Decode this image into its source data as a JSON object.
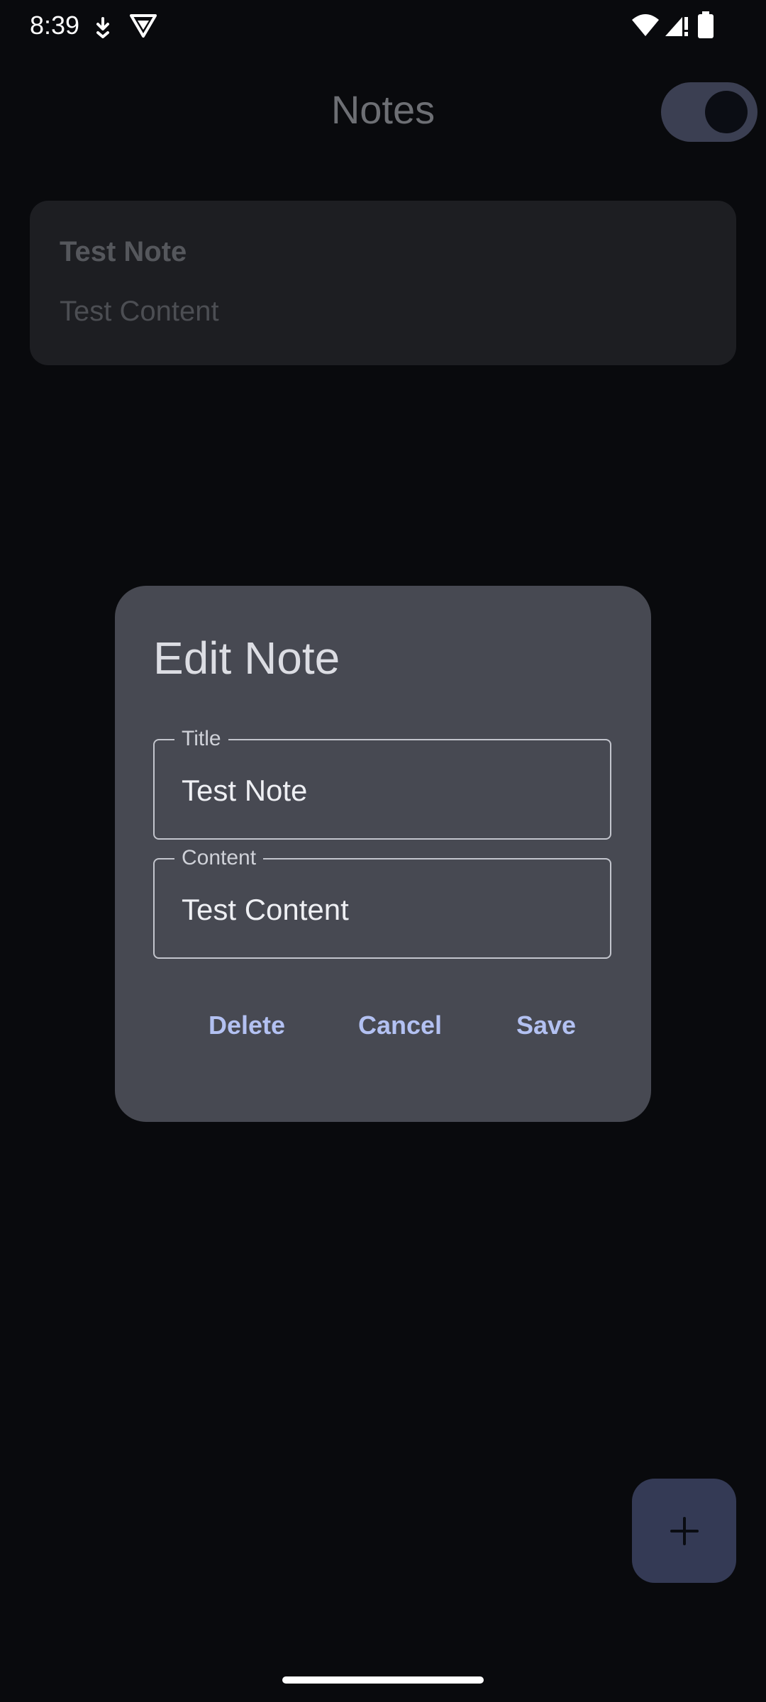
{
  "status_bar": {
    "time": "8:39",
    "icons": [
      "download-indicator-icon",
      "vpn-shield-icon",
      "wifi-icon",
      "signal-icon",
      "battery-icon"
    ]
  },
  "app_bar": {
    "title": "Notes",
    "theme_toggle_state": "dark"
  },
  "notes": [
    {
      "title": "Test Note",
      "content": "Test Content"
    }
  ],
  "dialog": {
    "title": "Edit Note",
    "title_field": {
      "label": "Title",
      "value": "Test Note"
    },
    "content_field": {
      "label": "Content",
      "value": "Test Content"
    },
    "buttons": {
      "delete": "Delete",
      "cancel": "Cancel",
      "save": "Save"
    }
  },
  "fab": {
    "icon": "plus-icon"
  },
  "colors": {
    "background": "#090a0d",
    "dialog_surface": "#474952",
    "accent": "#b3c1f2",
    "fab": "#343a55"
  }
}
